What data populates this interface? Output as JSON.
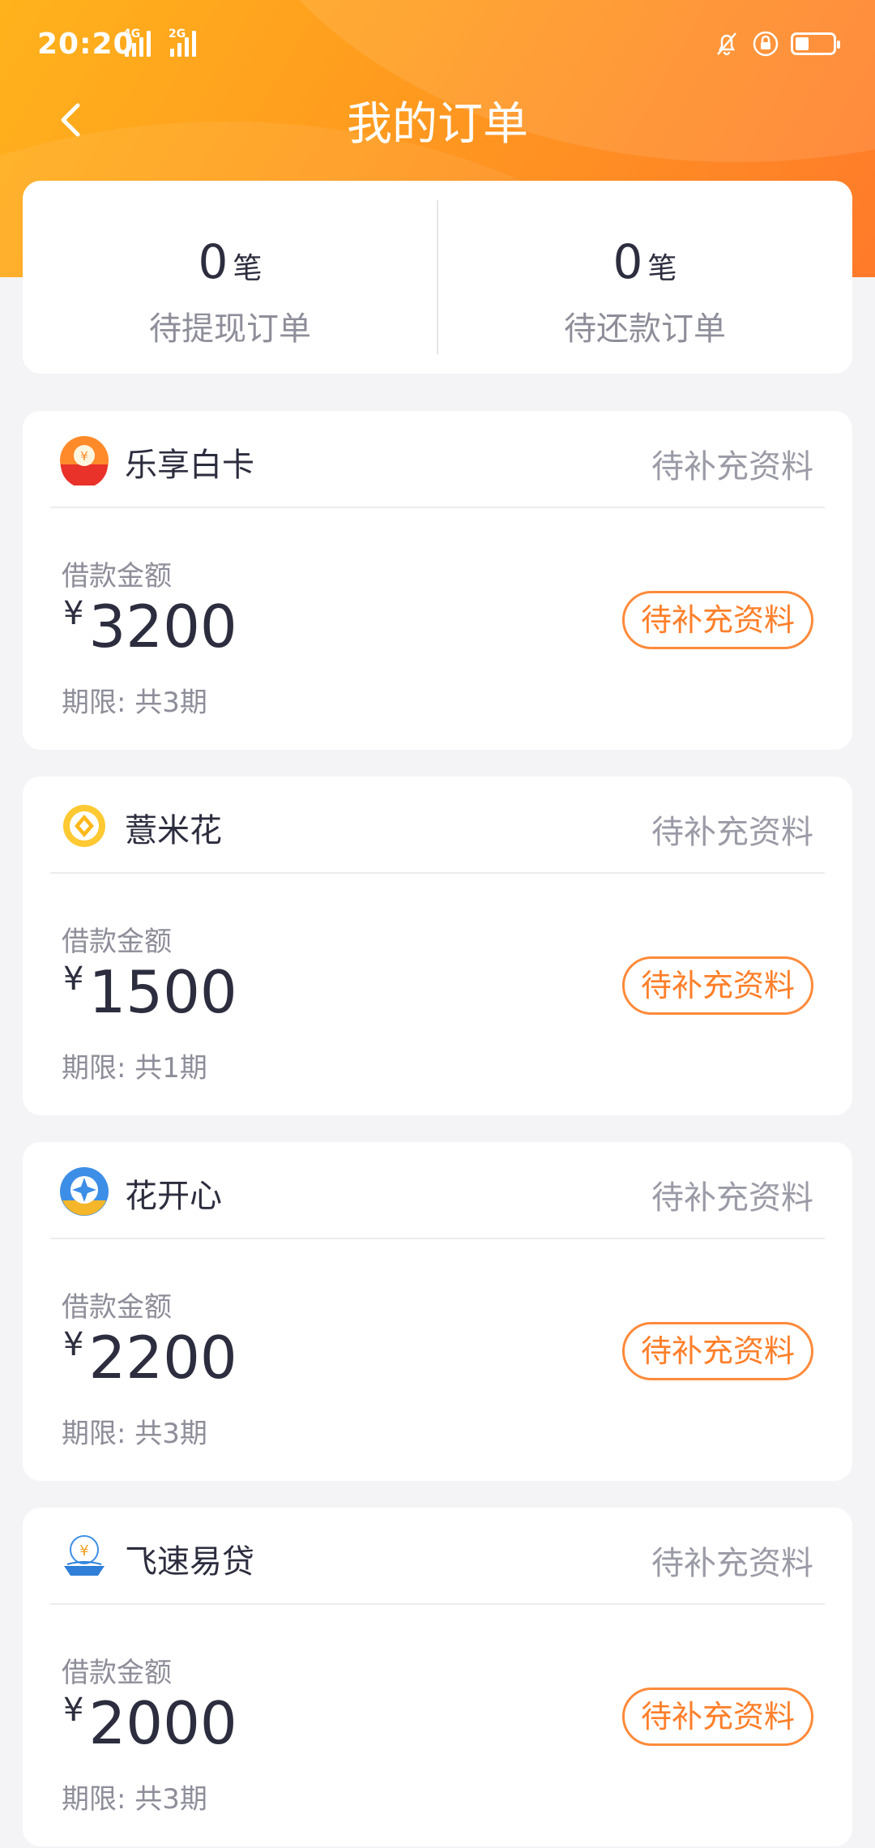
{
  "status_bar": {
    "time": "20:20",
    "net1": "4G",
    "net2": "2G"
  },
  "nav": {
    "title": "我的订单"
  },
  "summary": [
    {
      "count": "0",
      "unit": "笔",
      "label": "待提现订单"
    },
    {
      "count": "0",
      "unit": "笔",
      "label": "待还款订单"
    }
  ],
  "orders": [
    {
      "name": "乐享白卡",
      "status": "待补充资料",
      "amount_label": "借款金额",
      "currency": "¥",
      "amount": "3200",
      "term": "期限: 共3期",
      "action": "待补充资料",
      "logo_icon": "coin-logo-icon"
    },
    {
      "name": "薏米花",
      "status": "待补充资料",
      "amount_label": "借款金额",
      "currency": "¥",
      "amount": "1500",
      "term": "期限: 共1期",
      "action": "待补充资料",
      "logo_icon": "flower-logo-icon"
    },
    {
      "name": "花开心",
      "status": "待补充资料",
      "amount_label": "借款金额",
      "currency": "¥",
      "amount": "2200",
      "term": "期限: 共3期",
      "action": "待补充资料",
      "logo_icon": "star-logo-icon"
    },
    {
      "name": "飞速易贷",
      "status": "待补充资料",
      "amount_label": "借款金额",
      "currency": "¥",
      "amount": "2000",
      "term": "期限: 共3期",
      "action": "待补充资料",
      "logo_icon": "boat-logo-icon"
    }
  ],
  "colors": {
    "header_start": "#ffb21c",
    "header_end": "#ff7a2a",
    "accent": "#ff7f2a",
    "text": "#2c2d3e",
    "muted": "#8d8e99"
  }
}
